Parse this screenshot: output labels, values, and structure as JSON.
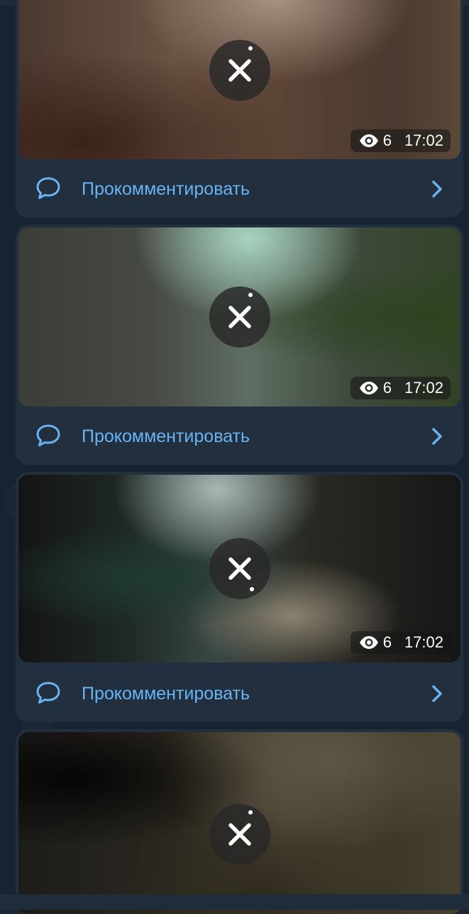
{
  "posts": [
    {
      "views": "6",
      "time": "17:02",
      "comment_label": "Прокомментировать"
    },
    {
      "views": "6",
      "time": "17:02",
      "comment_label": "Прокомментировать"
    },
    {
      "views": "6",
      "time": "17:02",
      "comment_label": "Прокомментировать"
    },
    {
      "views": "",
      "time": "",
      "comment_label": ""
    }
  ],
  "icons": {
    "cancel": "close-icon",
    "views": "eye-icon",
    "comment": "comment-bubble-icon",
    "chevron": "chevron-right-icon"
  },
  "colors": {
    "accent": "#6ab3f3",
    "bubble": "#212f3e",
    "background": "#182331"
  }
}
